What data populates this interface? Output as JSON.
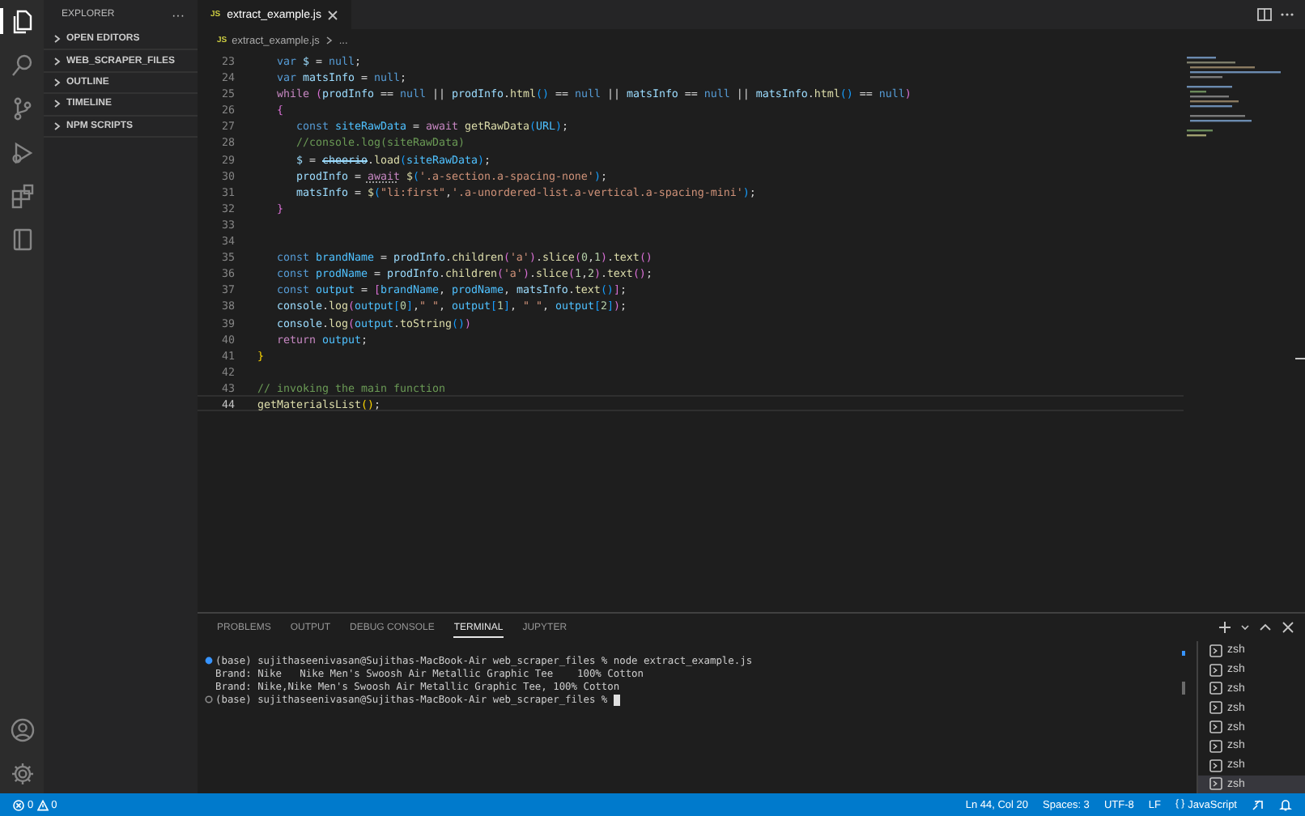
{
  "activity_bar": [
    {
      "kind": "files",
      "selected": true
    },
    {
      "kind": "search",
      "selected": false
    },
    {
      "kind": "branch",
      "selected": false
    },
    {
      "kind": "run",
      "selected": false
    },
    {
      "kind": "extensions",
      "selected": false
    },
    {
      "kind": "notebook",
      "selected": false
    }
  ],
  "activity_bottom": [
    {
      "kind": "account"
    },
    {
      "kind": "settings"
    }
  ],
  "sidebar": {
    "title": "EXPLORER",
    "more": "···",
    "sections": [
      {
        "label": "OPEN EDITORS",
        "expanded": false
      },
      {
        "label": "WEB_SCRAPER_FILES",
        "expanded": false
      },
      {
        "label": "OUTLINE",
        "expanded": false
      },
      {
        "label": "TIMELINE",
        "expanded": false
      },
      {
        "label": "NPM SCRIPTS",
        "expanded": false
      }
    ]
  },
  "tabs": [
    {
      "icon_text": "JS",
      "label": "extract_example.js",
      "selected": true
    }
  ],
  "breadcrumb": {
    "icon_text": "JS",
    "file": "extract_example.js",
    "trail": "..."
  },
  "code_lines": [
    {
      "n": "23",
      "current": false,
      "tokens": [
        {
          "kind": "kw",
          "text": "   var"
        },
        {
          "kind": "v",
          "text": " $"
        },
        {
          "kind": "p",
          "text": " ="
        },
        {
          "kind": "kw",
          "text": " null"
        },
        {
          "kind": "p",
          "text": ";"
        }
      ]
    },
    {
      "n": "24",
      "current": false,
      "tokens": [
        {
          "kind": "kw",
          "text": "   var"
        },
        {
          "kind": "v",
          "text": " matsInfo"
        },
        {
          "kind": "p",
          "text": " ="
        },
        {
          "kind": "kw",
          "text": " null"
        },
        {
          "kind": "p",
          "text": ";"
        }
      ]
    },
    {
      "n": "25",
      "current": false,
      "tokens": [
        {
          "kind": "ctl",
          "text": "   while"
        },
        {
          "kind": "b2",
          "text": " ("
        },
        {
          "kind": "v",
          "text": "prodInfo"
        },
        {
          "kind": "p",
          "text": " =="
        },
        {
          "kind": "kw",
          "text": " null"
        },
        {
          "kind": "p",
          "text": " ||"
        },
        {
          "kind": "v",
          "text": " prodInfo"
        },
        {
          "kind": "p",
          "text": "."
        },
        {
          "kind": "fn",
          "text": "html"
        },
        {
          "kind": "b3",
          "text": "()"
        },
        {
          "kind": "p",
          "text": " =="
        },
        {
          "kind": "kw",
          "text": " null"
        },
        {
          "kind": "p",
          "text": " ||"
        },
        {
          "kind": "v",
          "text": " matsInfo"
        },
        {
          "kind": "p",
          "text": " =="
        },
        {
          "kind": "kw",
          "text": " null"
        },
        {
          "kind": "p",
          "text": " ||"
        },
        {
          "kind": "v",
          "text": " matsInfo"
        },
        {
          "kind": "p",
          "text": "."
        },
        {
          "kind": "fn",
          "text": "html"
        },
        {
          "kind": "b3",
          "text": "()"
        },
        {
          "kind": "p",
          "text": " =="
        },
        {
          "kind": "kw",
          "text": " null"
        },
        {
          "kind": "b2",
          "text": ")"
        }
      ]
    },
    {
      "n": "26",
      "current": false,
      "tokens": [
        {
          "kind": "b2",
          "text": "   {"
        }
      ]
    },
    {
      "n": "27",
      "current": false,
      "tokens": [
        {
          "kind": "kw",
          "text": "      const"
        },
        {
          "kind": "c",
          "text": " siteRawData"
        },
        {
          "kind": "p",
          "text": " ="
        },
        {
          "kind": "ctl",
          "text": " await"
        },
        {
          "kind": "fn",
          "text": " getRawData"
        },
        {
          "kind": "b3",
          "text": "("
        },
        {
          "kind": "c",
          "text": "URL"
        },
        {
          "kind": "b3",
          "text": ")"
        },
        {
          "kind": "p",
          "text": ";"
        }
      ]
    },
    {
      "n": "28",
      "current": false,
      "tokens": [
        {
          "kind": "cm",
          "text": "      //console.log(siteRawData)"
        }
      ]
    },
    {
      "n": "29",
      "current": false,
      "tokens": [
        {
          "kind": "v",
          "text": "      $"
        },
        {
          "kind": "p",
          "text": " = "
        },
        {
          "kind": "strike",
          "text": "cheerio"
        },
        {
          "kind": "p",
          "text": "."
        },
        {
          "kind": "fn",
          "text": "load"
        },
        {
          "kind": "b3",
          "text": "("
        },
        {
          "kind": "c",
          "text": "siteRawData"
        },
        {
          "kind": "b3",
          "text": ")"
        },
        {
          "kind": "p",
          "text": ";"
        }
      ]
    },
    {
      "n": "30",
      "current": false,
      "tokens": [
        {
          "kind": "v",
          "text": "      prodInfo"
        },
        {
          "kind": "p",
          "text": " = "
        },
        {
          "kind": "warn",
          "text": "await"
        },
        {
          "kind": "fn",
          "text": " $"
        },
        {
          "kind": "b3",
          "text": "("
        },
        {
          "kind": "str",
          "text": "'.a-section.a-spacing-none'"
        },
        {
          "kind": "b3",
          "text": ")"
        },
        {
          "kind": "p",
          "text": ";"
        }
      ]
    },
    {
      "n": "31",
      "current": false,
      "tokens": [
        {
          "kind": "v",
          "text": "      matsInfo"
        },
        {
          "kind": "p",
          "text": " ="
        },
        {
          "kind": "fn",
          "text": " $"
        },
        {
          "kind": "b3",
          "text": "("
        },
        {
          "kind": "str",
          "text": "\"li:first\""
        },
        {
          "kind": "p",
          "text": ","
        },
        {
          "kind": "str",
          "text": "'.a-unordered-list.a-vertical.a-spacing-mini'"
        },
        {
          "kind": "b3",
          "text": ")"
        },
        {
          "kind": "p",
          "text": ";"
        }
      ]
    },
    {
      "n": "32",
      "current": false,
      "tokens": [
        {
          "kind": "b2",
          "text": "   }"
        }
      ]
    },
    {
      "n": "33",
      "current": false
    },
    {
      "n": "34",
      "current": false
    },
    {
      "n": "35",
      "current": false,
      "tokens": [
        {
          "kind": "kw",
          "text": "   const"
        },
        {
          "kind": "c",
          "text": " brandName"
        },
        {
          "kind": "p",
          "text": " ="
        },
        {
          "kind": "v",
          "text": " prodInfo"
        },
        {
          "kind": "p",
          "text": "."
        },
        {
          "kind": "fn",
          "text": "children"
        },
        {
          "kind": "b2",
          "text": "("
        },
        {
          "kind": "str",
          "text": "'a'"
        },
        {
          "kind": "b2",
          "text": ")"
        },
        {
          "kind": "p",
          "text": "."
        },
        {
          "kind": "fn",
          "text": "slice"
        },
        {
          "kind": "b2",
          "text": "("
        },
        {
          "kind": "num",
          "text": "0"
        },
        {
          "kind": "p",
          "text": ","
        },
        {
          "kind": "num",
          "text": "1"
        },
        {
          "kind": "b2",
          "text": ")"
        },
        {
          "kind": "p",
          "text": "."
        },
        {
          "kind": "fn",
          "text": "text"
        },
        {
          "kind": "b2",
          "text": "()"
        }
      ]
    },
    {
      "n": "36",
      "current": false,
      "tokens": [
        {
          "kind": "kw",
          "text": "   const"
        },
        {
          "kind": "c",
          "text": " prodName"
        },
        {
          "kind": "p",
          "text": " ="
        },
        {
          "kind": "v",
          "text": " prodInfo"
        },
        {
          "kind": "p",
          "text": "."
        },
        {
          "kind": "fn",
          "text": "children"
        },
        {
          "kind": "b2",
          "text": "("
        },
        {
          "kind": "str",
          "text": "'a'"
        },
        {
          "kind": "b2",
          "text": ")"
        },
        {
          "kind": "p",
          "text": "."
        },
        {
          "kind": "fn",
          "text": "slice"
        },
        {
          "kind": "b2",
          "text": "("
        },
        {
          "kind": "num",
          "text": "1"
        },
        {
          "kind": "p",
          "text": ","
        },
        {
          "kind": "num",
          "text": "2"
        },
        {
          "kind": "b2",
          "text": ")"
        },
        {
          "kind": "p",
          "text": "."
        },
        {
          "kind": "fn",
          "text": "text"
        },
        {
          "kind": "b2",
          "text": "()"
        },
        {
          "kind": "p",
          "text": ";"
        }
      ]
    },
    {
      "n": "37",
      "current": false,
      "tokens": [
        {
          "kind": "kw",
          "text": "   const"
        },
        {
          "kind": "c",
          "text": " output"
        },
        {
          "kind": "p",
          "text": " ="
        },
        {
          "kind": "b2",
          "text": " ["
        },
        {
          "kind": "c",
          "text": "brandName"
        },
        {
          "kind": "p",
          "text": ","
        },
        {
          "kind": "c",
          "text": " prodName"
        },
        {
          "kind": "p",
          "text": ","
        },
        {
          "kind": "v",
          "text": " matsInfo"
        },
        {
          "kind": "p",
          "text": "."
        },
        {
          "kind": "fn",
          "text": "text"
        },
        {
          "kind": "b3",
          "text": "()"
        },
        {
          "kind": "b2",
          "text": "]"
        },
        {
          "kind": "p",
          "text": ";"
        }
      ]
    },
    {
      "n": "38",
      "current": false,
      "tokens": [
        {
          "kind": "v",
          "text": "   console"
        },
        {
          "kind": "p",
          "text": "."
        },
        {
          "kind": "fn",
          "text": "log"
        },
        {
          "kind": "b2",
          "text": "("
        },
        {
          "kind": "c",
          "text": "output"
        },
        {
          "kind": "b3",
          "text": "["
        },
        {
          "kind": "num",
          "text": "0"
        },
        {
          "kind": "b3",
          "text": "]"
        },
        {
          "kind": "p",
          "text": ","
        },
        {
          "kind": "str",
          "text": "\" \""
        },
        {
          "kind": "p",
          "text": ","
        },
        {
          "kind": "c",
          "text": " output"
        },
        {
          "kind": "b3",
          "text": "["
        },
        {
          "kind": "num",
          "text": "1"
        },
        {
          "kind": "b3",
          "text": "]"
        },
        {
          "kind": "p",
          "text": ","
        },
        {
          "kind": "str",
          "text": " \" \""
        },
        {
          "kind": "p",
          "text": ","
        },
        {
          "kind": "c",
          "text": " output"
        },
        {
          "kind": "b3",
          "text": "["
        },
        {
          "kind": "num",
          "text": "2"
        },
        {
          "kind": "b3",
          "text": "]"
        },
        {
          "kind": "b2",
          "text": ")"
        },
        {
          "kind": "p",
          "text": ";"
        }
      ]
    },
    {
      "n": "39",
      "current": false,
      "tokens": [
        {
          "kind": "v",
          "text": "   console"
        },
        {
          "kind": "p",
          "text": "."
        },
        {
          "kind": "fn",
          "text": "log"
        },
        {
          "kind": "b2",
          "text": "("
        },
        {
          "kind": "c",
          "text": "output"
        },
        {
          "kind": "p",
          "text": "."
        },
        {
          "kind": "fn",
          "text": "toString"
        },
        {
          "kind": "b3",
          "text": "()"
        },
        {
          "kind": "b2",
          "text": ")"
        }
      ]
    },
    {
      "n": "40",
      "current": false,
      "tokens": [
        {
          "kind": "ctl",
          "text": "   return"
        },
        {
          "kind": "c",
          "text": " output"
        },
        {
          "kind": "p",
          "text": ";"
        }
      ]
    },
    {
      "n": "41",
      "current": false,
      "tokens": [
        {
          "kind": "b1",
          "text": "}"
        }
      ]
    },
    {
      "n": "42",
      "current": false
    },
    {
      "n": "43",
      "current": false,
      "tokens": [
        {
          "kind": "cm",
          "text": "// invoking the main function"
        }
      ]
    },
    {
      "n": "44",
      "current": true,
      "tokens": [
        {
          "kind": "fn",
          "text": "getMaterialsList"
        },
        {
          "kind": "b1",
          "text": "()"
        },
        {
          "kind": "p",
          "text": ";"
        }
      ]
    }
  ],
  "panel_tabs": [
    {
      "label": "PROBLEMS",
      "selected": false
    },
    {
      "label": "OUTPUT",
      "selected": false
    },
    {
      "label": "DEBUG CONSOLE",
      "selected": false
    },
    {
      "label": "TERMINAL",
      "selected": true
    },
    {
      "label": "JUPYTER",
      "selected": false
    }
  ],
  "terminal_lines": [
    {
      "kind": "success",
      "cursor": false,
      "text": "(base) sujithaseenivasan@Sujithas-MacBook-Air web_scraper_files % node extract_example.js"
    },
    {
      "kind": "output",
      "cursor": false,
      "text": "Brand: Nike   Nike Men's Swoosh Air Metallic Graphic Tee    100% Cotton"
    },
    {
      "kind": "output",
      "cursor": false,
      "text": "Brand: Nike,Nike Men's Swoosh Air Metallic Graphic Tee, 100% Cotton"
    },
    {
      "kind": "pending",
      "cursor": true,
      "text": "(base) sujithaseenivasan@Sujithas-MacBook-Air web_scraper_files %"
    }
  ],
  "terminals": [
    {
      "label": "zsh",
      "selected": false
    },
    {
      "label": "zsh",
      "selected": false
    },
    {
      "label": "zsh",
      "selected": false
    },
    {
      "label": "zsh",
      "selected": false
    },
    {
      "label": "zsh",
      "selected": false
    },
    {
      "label": "zsh",
      "selected": false
    },
    {
      "label": "zsh",
      "selected": false
    },
    {
      "label": "zsh",
      "selected": true
    }
  ],
  "status_bar": {
    "errors": "0",
    "warnings": "0",
    "right": [
      "Ln 44, Col 20",
      "Spaces: 3",
      "UTF-8",
      "LF"
    ],
    "language": "JavaScript",
    "language_icon": "{ }"
  }
}
